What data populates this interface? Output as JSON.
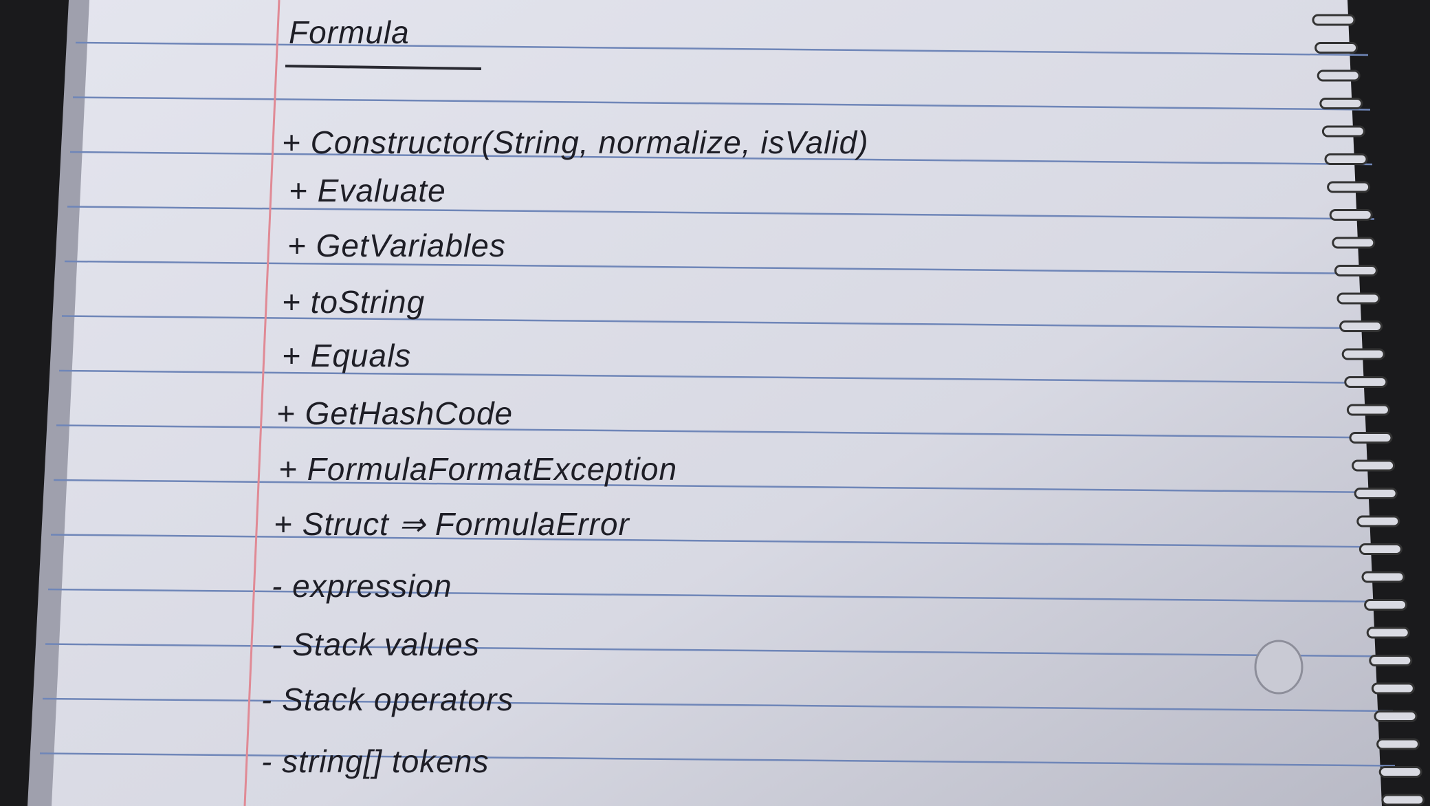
{
  "page": {
    "title": "Formula",
    "lines": [
      {
        "text": "+ Constructor(String, normalize, isValid)"
      },
      {
        "text": "+ Evaluate"
      },
      {
        "text": "+ GetVariables"
      },
      {
        "text": "+ toString"
      },
      {
        "text": "+ Equals"
      },
      {
        "text": "+ GetHashCode"
      },
      {
        "text": "+ FormulaFormatException"
      },
      {
        "text": "+ Struct ⇒ FormulaError"
      },
      {
        "text": "- expression"
      },
      {
        "text": "- Stack values"
      },
      {
        "text": "- Stack operators"
      },
      {
        "text": "- string[] tokens"
      }
    ]
  },
  "colors": {
    "paper": "#dcdde6",
    "rule": "#6f86b8",
    "margin": "#e08a95",
    "ink": "#1e1e26"
  }
}
